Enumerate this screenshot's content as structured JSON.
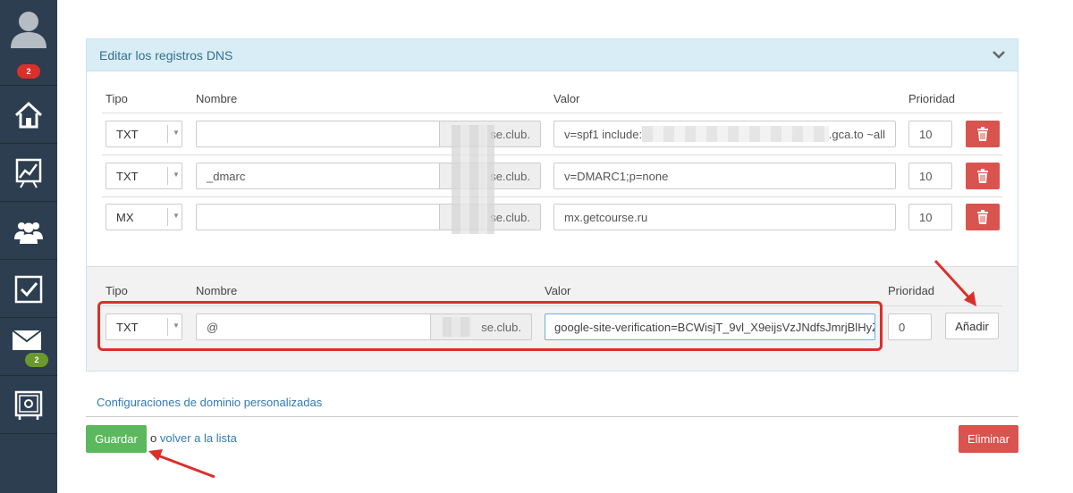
{
  "sidebar": {
    "notifications_badge": "2",
    "messages_badge": "2",
    "items": [
      {
        "icon": "home-icon"
      },
      {
        "icon": "chart-icon"
      },
      {
        "icon": "users-icon"
      },
      {
        "icon": "tasks-icon"
      },
      {
        "icon": "mail-icon"
      },
      {
        "icon": "safe-icon"
      }
    ]
  },
  "panel": {
    "title": "Editar los registros DNS"
  },
  "headers": {
    "tipo": "Tipo",
    "nombre": "Nombre",
    "valor": "Valor",
    "prioridad": "Prioridad"
  },
  "records": [
    {
      "tipo": "TXT",
      "nombre": "",
      "suffix": "se.club.",
      "valor_start": "v=spf1 include:",
      "valor_end": ".gca.to ~all",
      "prioridad": "10"
    },
    {
      "tipo": "TXT",
      "nombre": "_dmarc",
      "suffix": "se.club.",
      "valor_start": "v=DMARC1;p=none",
      "valor_end": "",
      "prioridad": "10"
    },
    {
      "tipo": "MX",
      "nombre": "",
      "suffix": "se.club.",
      "valor_start": "mx.getcourse.ru",
      "valor_end": "",
      "prioridad": "10"
    }
  ],
  "new_record": {
    "tipo": "TXT",
    "nombre": "@",
    "suffix": "se.club.",
    "valor": "google-site-verification=BCWisjT_9vl_X9eijsVzJNdfsJmrjBlHyZ",
    "prioridad": "0",
    "add_label": "Añadir"
  },
  "footer": {
    "custom_domain_link": "Configuraciones de dominio personalizadas",
    "save_label": "Guardar",
    "or_text": "o",
    "back_link": "volver a la lista",
    "delete_label": "Eliminar"
  },
  "colors": {
    "sidebar": "#2c3e50",
    "save": "#5cb85c",
    "danger": "#d9534f",
    "highlight": "#d9302c",
    "link": "#337ab7"
  }
}
